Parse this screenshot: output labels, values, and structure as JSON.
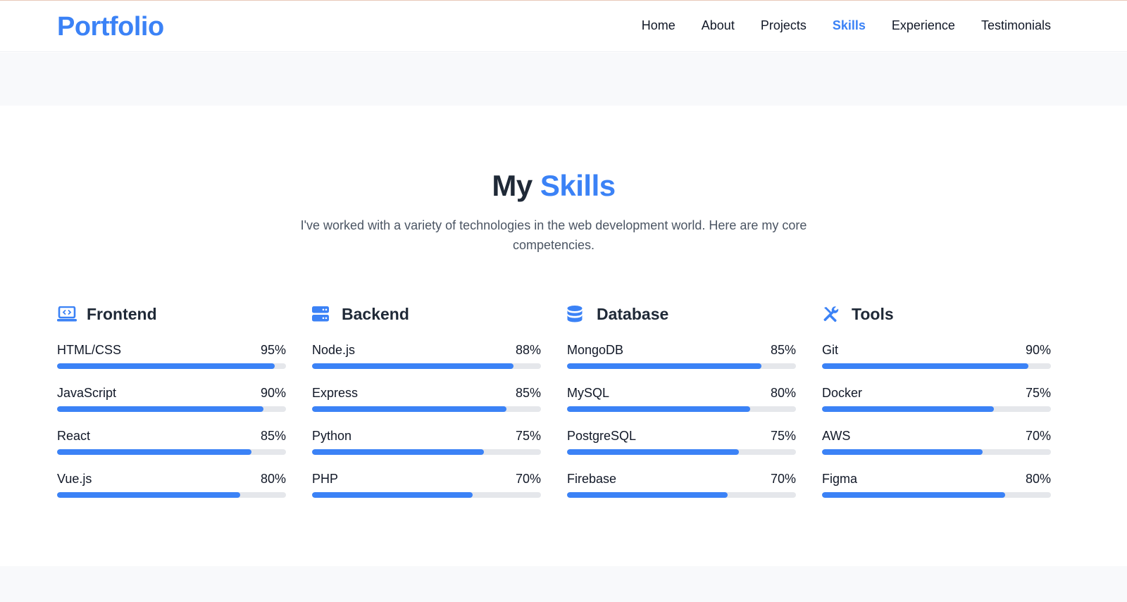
{
  "brand": {
    "logo": "Portfolio",
    "accent_color": "#3b82f6"
  },
  "nav": {
    "items": [
      {
        "label": "Home",
        "active": false
      },
      {
        "label": "About",
        "active": false
      },
      {
        "label": "Projects",
        "active": false
      },
      {
        "label": "Skills",
        "active": true
      },
      {
        "label": "Experience",
        "active": false
      },
      {
        "label": "Testimonials",
        "active": false
      }
    ]
  },
  "section": {
    "title_plain": "My",
    "title_accent": "Skills",
    "subtitle": "I've worked with a variety of technologies in the web development world. Here are my core competencies."
  },
  "categories": [
    {
      "title": "Frontend",
      "icon": "laptop-code-icon",
      "skills": [
        {
          "name": "HTML/CSS",
          "percent_label": "95%",
          "level": 95
        },
        {
          "name": "JavaScript",
          "percent_label": "90%",
          "level": 90
        },
        {
          "name": "React",
          "percent_label": "85%",
          "level": 85
        },
        {
          "name": "Vue.js",
          "percent_label": "80%",
          "level": 80
        }
      ]
    },
    {
      "title": "Backend",
      "icon": "server-icon",
      "skills": [
        {
          "name": "Node.js",
          "percent_label": "88%",
          "level": 88
        },
        {
          "name": "Express",
          "percent_label": "85%",
          "level": 85
        },
        {
          "name": "Python",
          "percent_label": "75%",
          "level": 75
        },
        {
          "name": "PHP",
          "percent_label": "70%",
          "level": 70
        }
      ]
    },
    {
      "title": "Database",
      "icon": "database-icon",
      "skills": [
        {
          "name": "MongoDB",
          "percent_label": "85%",
          "level": 85
        },
        {
          "name": "MySQL",
          "percent_label": "80%",
          "level": 80
        },
        {
          "name": "PostgreSQL",
          "percent_label": "75%",
          "level": 75
        },
        {
          "name": "Firebase",
          "percent_label": "70%",
          "level": 70
        }
      ]
    },
    {
      "title": "Tools",
      "icon": "tools-icon",
      "skills": [
        {
          "name": "Git",
          "percent_label": "90%",
          "level": 90
        },
        {
          "name": "Docker",
          "percent_label": "75%",
          "level": 75
        },
        {
          "name": "AWS",
          "percent_label": "70%",
          "level": 70
        },
        {
          "name": "Figma",
          "percent_label": "80%",
          "level": 80
        }
      ]
    }
  ]
}
